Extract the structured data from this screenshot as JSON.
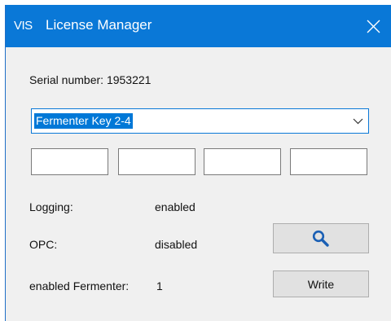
{
  "window": {
    "app_icon_text": "VIS",
    "title": "License Manager",
    "close_icon": "close-icon"
  },
  "serial": {
    "label": "Serial number:",
    "value": "1953221"
  },
  "key_select": {
    "selected": "Fermenter Key 2-4",
    "icon": "chevron-down-icon"
  },
  "key_fields": [
    {
      "value": ""
    },
    {
      "value": ""
    },
    {
      "value": ""
    },
    {
      "value": ""
    }
  ],
  "status": {
    "logging_label": "Logging:",
    "logging_value": "enabled",
    "opc_label": "OPC:",
    "opc_value": "disabled",
    "fermenter_label": "enabled Fermenter:",
    "fermenter_value": "1"
  },
  "buttons": {
    "search_icon": "search-icon",
    "write_label": "Write"
  },
  "colors": {
    "titlebar": "#0a78d7",
    "selection": "#0078d7",
    "search_icon": "#1a5fb4"
  }
}
